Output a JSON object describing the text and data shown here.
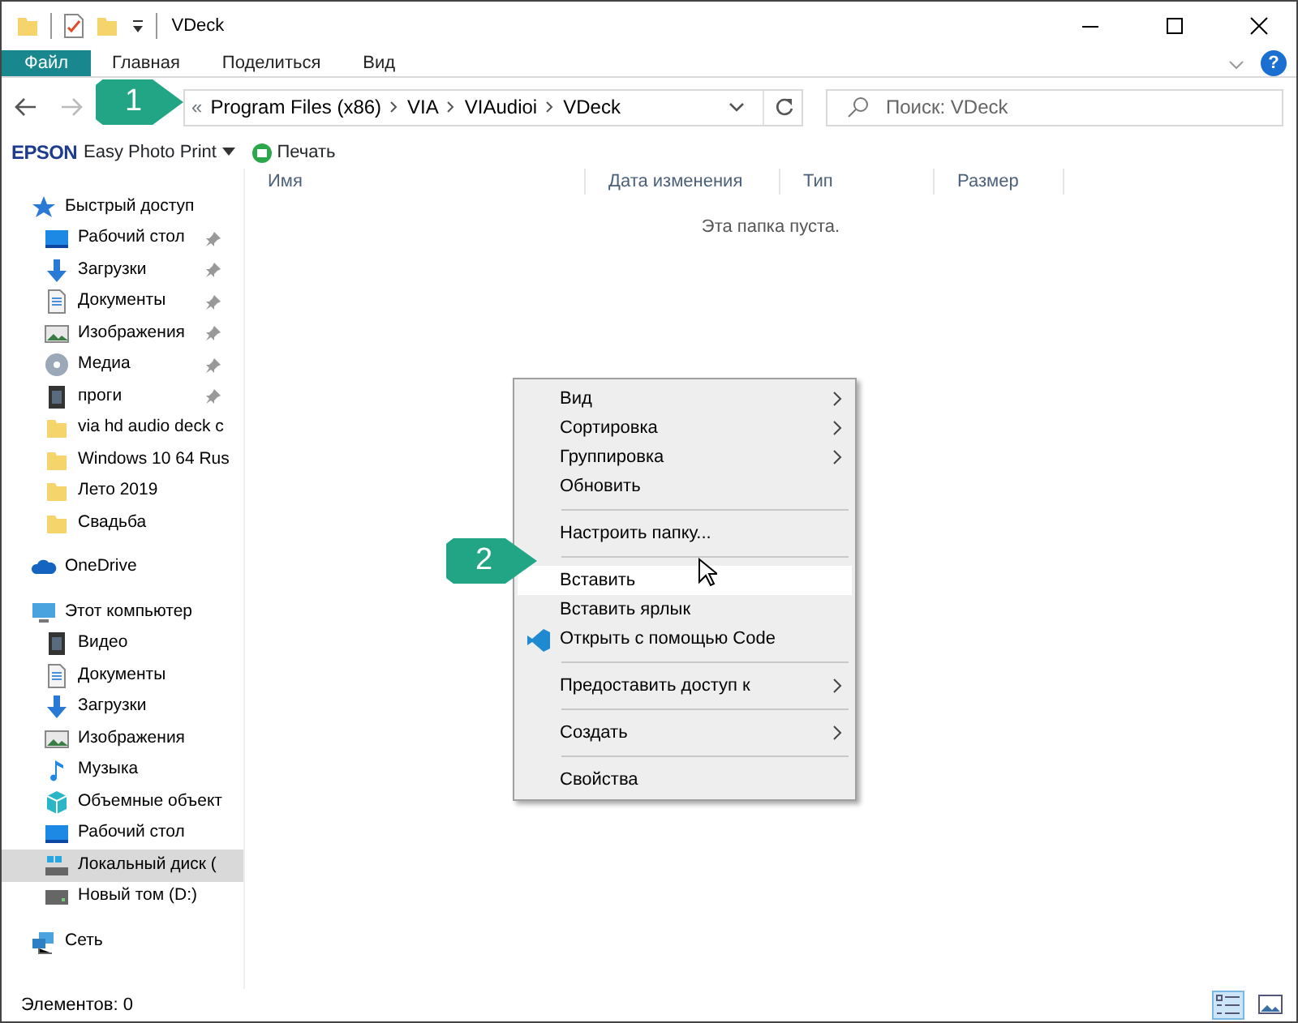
{
  "window": {
    "title": "VDeck"
  },
  "ribbon_tabs": [
    {
      "label": "Файл",
      "selected": true
    },
    {
      "label": "Главная",
      "selected": false
    },
    {
      "label": "Поделиться",
      "selected": false
    },
    {
      "label": "Вид",
      "selected": false
    }
  ],
  "help": "?",
  "address": {
    "overflow": "«",
    "path": [
      "Program Files (x86)",
      "VIA",
      "VIAudioi",
      "VDeck"
    ]
  },
  "search": {
    "placeholder": "Поиск: VDeck"
  },
  "toolbar": {
    "brand": "EPSON",
    "app": "Easy Photo Print",
    "print": "Печать"
  },
  "sidebar": [
    {
      "label": "Быстрый доступ",
      "kind": "quick",
      "selected": false,
      "children": [
        {
          "label": "Рабочий стол",
          "kind": "desktop",
          "pinned": true,
          "selected": false
        },
        {
          "label": "Загрузки",
          "kind": "downloads",
          "pinned": true,
          "selected": false
        },
        {
          "label": "Документы",
          "kind": "documents",
          "pinned": true,
          "selected": false
        },
        {
          "label": "Изображения",
          "kind": "pictures",
          "pinned": true,
          "selected": false
        },
        {
          "label": "Медиа",
          "kind": "media",
          "pinned": true,
          "selected": false
        },
        {
          "label": "проги",
          "kind": "film",
          "pinned": true,
          "selected": false
        },
        {
          "label": "via hd audio deck c",
          "kind": "folder",
          "pinned": false,
          "selected": false
        },
        {
          "label": "Windows 10 64 Rus",
          "kind": "folder",
          "pinned": false,
          "selected": false
        },
        {
          "label": "Лето 2019",
          "kind": "folder",
          "pinned": false,
          "selected": false
        },
        {
          "label": "Свадьба",
          "kind": "folder",
          "pinned": false,
          "selected": false
        }
      ]
    },
    {
      "label": "OneDrive",
      "kind": "onedrive",
      "selected": false
    },
    {
      "label": "Этот компьютер",
      "kind": "pc",
      "selected": false,
      "children": [
        {
          "label": "Видео",
          "kind": "film",
          "selected": false
        },
        {
          "label": "Документы",
          "kind": "documents",
          "selected": false
        },
        {
          "label": "Загрузки",
          "kind": "downloads",
          "selected": false
        },
        {
          "label": "Изображения",
          "kind": "pictures",
          "selected": false
        },
        {
          "label": "Музыка",
          "kind": "music",
          "selected": false
        },
        {
          "label": "Объемные объект",
          "kind": "objects3d",
          "selected": false
        },
        {
          "label": "Рабочий стол",
          "kind": "desktop",
          "selected": false
        },
        {
          "label": "Локальный диск (",
          "kind": "drive_c",
          "selected": true
        },
        {
          "label": "Новый том (D:)",
          "kind": "drive",
          "selected": false
        }
      ]
    },
    {
      "label": "Сеть",
      "kind": "network",
      "selected": false
    }
  ],
  "columns": [
    "Имя",
    "Дата изменения",
    "Тип",
    "Размер"
  ],
  "empty_message": "Эта папка пуста.",
  "context_menu": [
    [
      {
        "label": "Вид",
        "submenu": true,
        "selected": false
      },
      {
        "label": "Сортировка",
        "submenu": true,
        "selected": false
      },
      {
        "label": "Группировка",
        "submenu": true,
        "selected": false
      },
      {
        "label": "Обновить",
        "submenu": false,
        "selected": false
      }
    ],
    [
      {
        "label": "Настроить папку...",
        "submenu": false,
        "selected": false
      }
    ],
    [
      {
        "label": "Вставить",
        "submenu": false,
        "selected": true
      },
      {
        "label": "Вставить ярлык",
        "submenu": false,
        "selected": false
      },
      {
        "label": "Открыть с помощью Code",
        "submenu": false,
        "selected": false,
        "kind": "code"
      }
    ],
    [
      {
        "label": "Предоставить доступ к",
        "submenu": true,
        "selected": false
      }
    ],
    [
      {
        "label": "Создать",
        "submenu": true,
        "selected": false
      }
    ],
    [
      {
        "label": "Свойства",
        "submenu": false,
        "selected": false
      }
    ]
  ],
  "callouts": [
    "1",
    "2"
  ],
  "status_bar": {
    "text": "Элементов: 0",
    "views": [
      {
        "kind": "details",
        "selected": true
      },
      {
        "kind": "tiles",
        "selected": false
      }
    ]
  }
}
